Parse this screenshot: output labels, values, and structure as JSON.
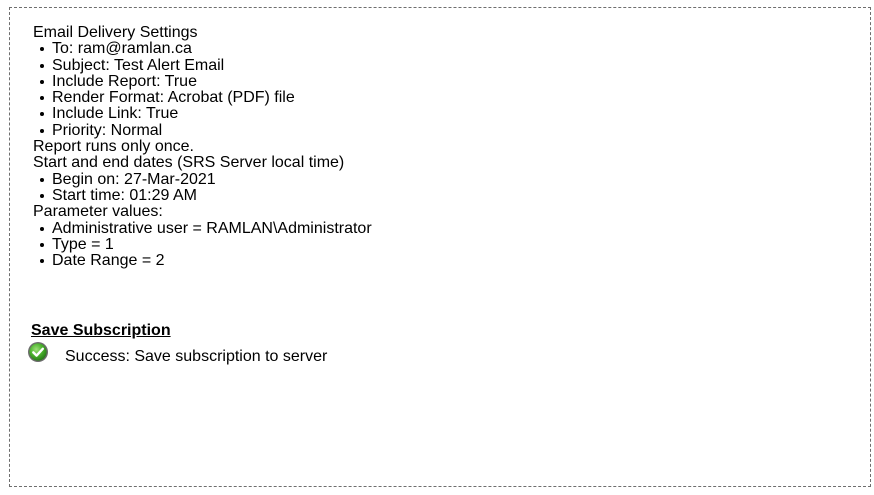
{
  "email_delivery": {
    "heading": "Email Delivery Settings",
    "items": [
      "To: ram@ramlan.ca",
      "Subject: Test Alert Email",
      "Include Report: True",
      "Render Format: Acrobat (PDF) file",
      "Include Link: True",
      "Priority: Normal"
    ]
  },
  "schedule": {
    "runs_text": "Report runs only once.",
    "dates_heading": "Start and end dates (SRS Server local time)",
    "items": [
      "Begin on: 27-Mar-2021",
      "Start time: 01:29 AM"
    ]
  },
  "parameters": {
    "heading": "Parameter values:",
    "items": [
      "Administrative user = RAMLAN\\Administrator",
      "Type = 1",
      "Date Range = 2"
    ]
  },
  "save_subscription": {
    "heading": "Save Subscription",
    "status_icon": "success-check-icon",
    "status_color": "#3a9a2a",
    "status_text": "Success: Save subscription to server"
  }
}
